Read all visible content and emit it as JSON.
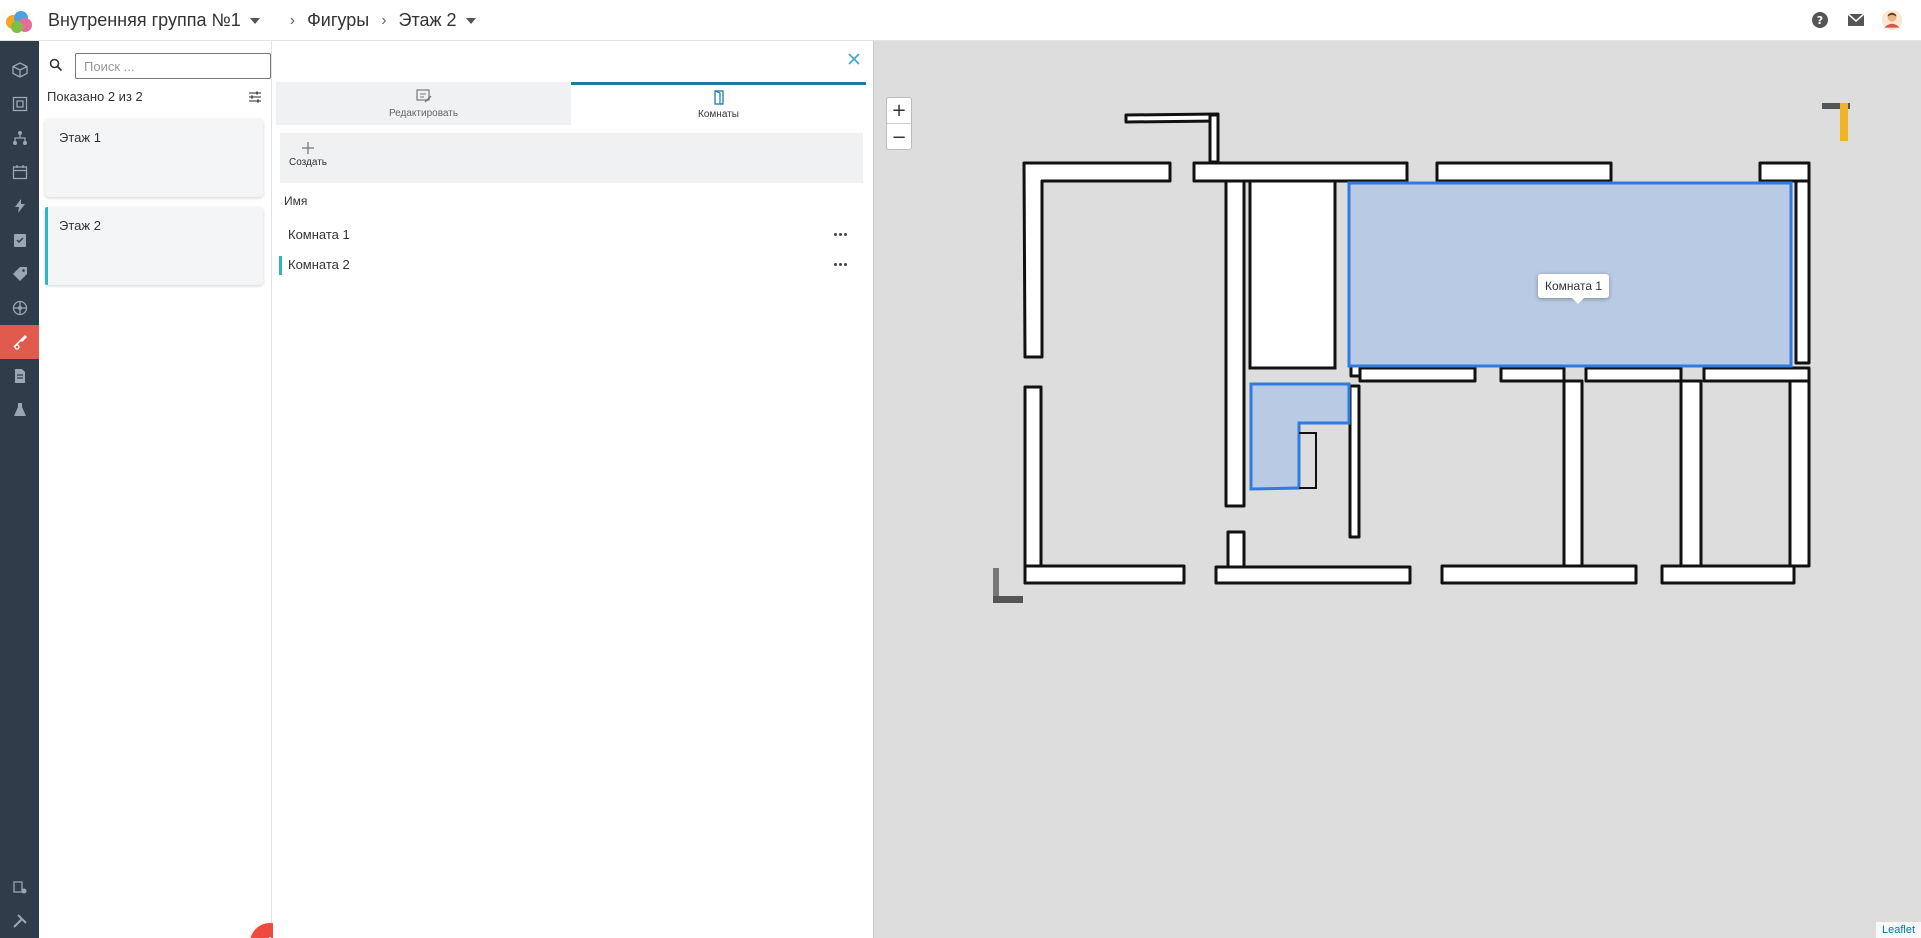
{
  "header": {
    "breadcrumbs": [
      {
        "label": "Внутренняя группа №1",
        "has_dropdown": true
      },
      {
        "label": "Фигуры",
        "has_dropdown": false
      },
      {
        "label": "Этаж 2",
        "has_dropdown": true
      }
    ],
    "separator": "›",
    "actions": [
      "help-icon",
      "mail-icon",
      "user-avatar-icon"
    ]
  },
  "rail": {
    "items": [
      "cube-icon",
      "frame-icon",
      "hierarchy-icon",
      "calendar-icon",
      "lightning-icon",
      "checklist-icon",
      "tag-icon",
      "network-icon",
      "floorplan-icon",
      "document-icon",
      "flask-icon",
      "settings-list-icon",
      "tools-icon"
    ],
    "active": "floorplan-icon"
  },
  "floors_panel": {
    "search_placeholder": "Поиск ...",
    "shown_text": "Показано 2 из 2",
    "items": [
      {
        "label": "Этаж 1",
        "selected": false
      },
      {
        "label": "Этаж 2",
        "selected": true
      }
    ],
    "fab": "+"
  },
  "detail_panel": {
    "tabs": [
      {
        "label": "Редактировать",
        "icon": "edit-icon",
        "active": false
      },
      {
        "label": "Комнаты",
        "icon": "door-icon",
        "active": true
      }
    ],
    "toolbar": {
      "create_label": "Создать"
    },
    "column_header": "Имя",
    "rooms": [
      {
        "name": "Комната 1",
        "selected": false
      },
      {
        "name": "Комната 2",
        "selected": true
      }
    ]
  },
  "map": {
    "zoom_in": "+",
    "zoom_out": "−",
    "tooltip": "Комната 1",
    "attribution": "Leaflet",
    "room_fill_color": "#b9cbe4",
    "room_stroke_color": "#2f7be0"
  }
}
